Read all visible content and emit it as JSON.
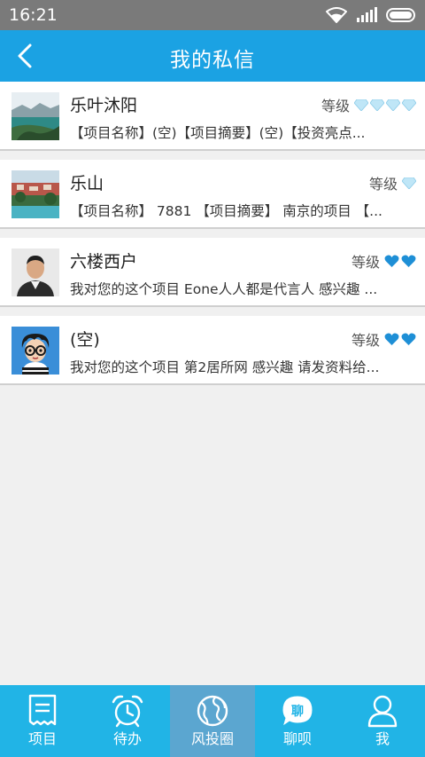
{
  "status_bar": {
    "time": "16:21"
  },
  "header": {
    "title": "我的私信"
  },
  "messages": [
    {
      "name": "乐叶沐阳",
      "level_label": "等级",
      "summary": "【项目名称】(空)【项目摘要】(空)【投资亮点...",
      "level_gems": 4,
      "gem_color": "#bfe6f7"
    },
    {
      "name": "乐山",
      "level_label": "等级",
      "summary": "【项目名称】 7881 【项目摘要】 南京的项目 【...",
      "level_gems": 1,
      "gem_color": "#bfe6f7"
    },
    {
      "name": "六楼西户",
      "level_label": "等级",
      "summary": "我对您的这个项目  Eone人人都是代言人  感兴趣 ...",
      "level_gems": 2,
      "gem_color": "#1e8fd6"
    },
    {
      "name": "(空)",
      "level_label": "等级",
      "summary": "我对您的这个项目  第2居所网  感兴趣 请发资料给...",
      "level_gems": 2,
      "gem_color": "#1e8fd6"
    }
  ],
  "tabs": [
    {
      "label": "项目",
      "icon": "document-icon"
    },
    {
      "label": "待办",
      "icon": "alarm-clock-icon"
    },
    {
      "label": "风投圈",
      "icon": "globe-icon"
    },
    {
      "label": "聊呗",
      "icon": "chat-icon",
      "icon_text": "聊"
    },
    {
      "label": "我",
      "icon": "person-icon"
    }
  ],
  "active_tab": "风投圈"
}
